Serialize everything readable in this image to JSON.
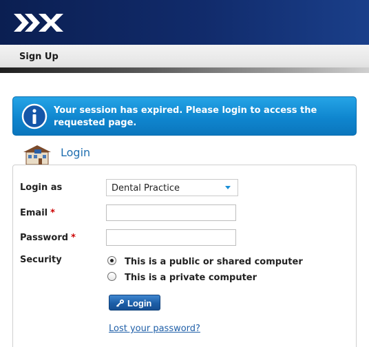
{
  "nav": {
    "signup_label": "Sign Up"
  },
  "alert": {
    "message": "Your session has expired. Please login to access the requested page."
  },
  "login": {
    "heading": "Login",
    "fields": {
      "login_as": {
        "label": "Login as",
        "value": "Dental Practice"
      },
      "email": {
        "label": "Email",
        "required_mark": "*",
        "value": ""
      },
      "password": {
        "label": "Password",
        "required_mark": "*",
        "value": ""
      }
    },
    "security": {
      "label": "Security",
      "options": [
        {
          "label": "This is a public or shared computer",
          "selected": true
        },
        {
          "label": "This is a private computer",
          "selected": false
        }
      ]
    },
    "button_label": "Login",
    "lost_password_link": "Lost your password?"
  },
  "colors": {
    "header_bg": "#112b6b",
    "alert_bg": "#0f86cf",
    "link": "#1f5fa8",
    "heading": "#1f6fb0"
  }
}
